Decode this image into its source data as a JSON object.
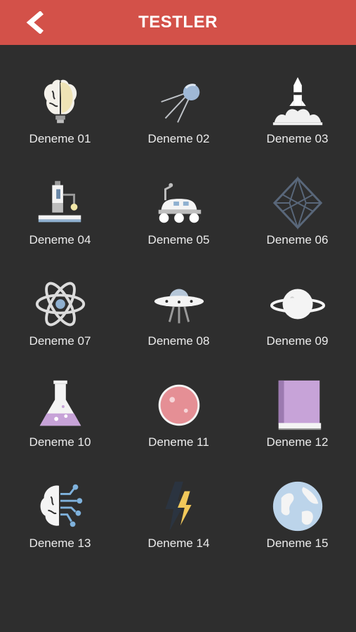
{
  "header": {
    "title": "TESTLER",
    "back_icon": "chevron-left-icon"
  },
  "tests": [
    {
      "label": "Deneme 01",
      "icon": "brain-bulb-icon"
    },
    {
      "label": "Deneme 02",
      "icon": "satellite-icon"
    },
    {
      "label": "Deneme 03",
      "icon": "rocket-launch-icon"
    },
    {
      "label": "Deneme 04",
      "icon": "microscope-icon"
    },
    {
      "label": "Deneme 05",
      "icon": "rover-icon"
    },
    {
      "label": "Deneme 06",
      "icon": "crystal-icon"
    },
    {
      "label": "Deneme 07",
      "icon": "atom-icon"
    },
    {
      "label": "Deneme 08",
      "icon": "ufo-icon"
    },
    {
      "label": "Deneme 09",
      "icon": "ringed-planet-icon"
    },
    {
      "label": "Deneme 10",
      "icon": "flask-icon"
    },
    {
      "label": "Deneme 11",
      "icon": "planet-icon"
    },
    {
      "label": "Deneme 12",
      "icon": "book-icon"
    },
    {
      "label": "Deneme 13",
      "icon": "ai-brain-icon"
    },
    {
      "label": "Deneme 14",
      "icon": "lightning-icon"
    },
    {
      "label": "Deneme 15",
      "icon": "globe-icon"
    }
  ],
  "colors": {
    "header": "#d35149",
    "background": "#2e2e2e",
    "text": "#ececec"
  }
}
